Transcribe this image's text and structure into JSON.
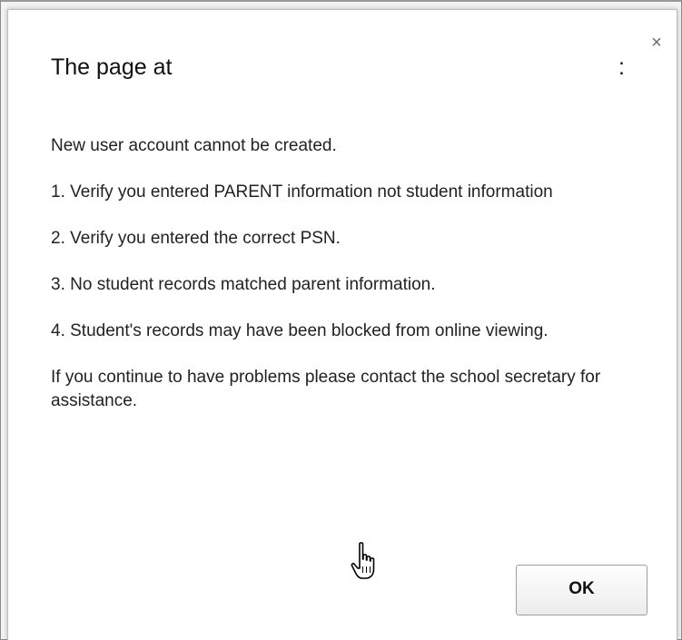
{
  "dialog": {
    "title_prefix": "The page at",
    "title_suffix": ":",
    "close_glyph": "×",
    "messages": [
      "New user account cannot be created.",
      "1. Verify you entered PARENT information not student information",
      "2. Verify you entered the correct PSN.",
      "3. No student records matched parent information.",
      "4. Student's records may have been blocked from online viewing.",
      "If you continue to have problems please contact the school secretary for assistance."
    ],
    "ok_label": "OK"
  },
  "cursor": {
    "icon": "hand-pointer-icon"
  }
}
